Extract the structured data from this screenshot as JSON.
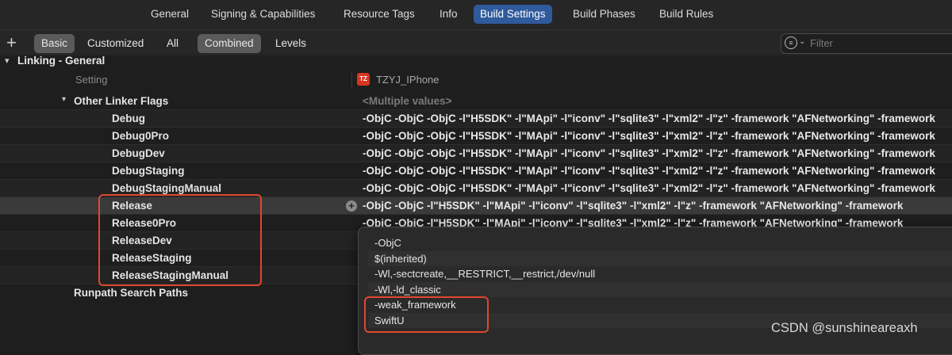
{
  "tabs": [
    {
      "label": "General"
    },
    {
      "label": "Signing & Capabilities"
    },
    {
      "label": "Resource Tags"
    },
    {
      "label": "Info"
    },
    {
      "label": "Build Settings",
      "active": true
    },
    {
      "label": "Build Phases"
    },
    {
      "label": "Build Rules"
    }
  ],
  "toolbar": {
    "add_label": "+",
    "scope": [
      "Basic",
      "Customized",
      "All"
    ],
    "view": [
      "Combined",
      "Levels"
    ],
    "filter_placeholder": "Filter"
  },
  "section": {
    "title": "Linking - General"
  },
  "header": {
    "setting_label": "Setting",
    "target_name": "TZYJ_IPhone",
    "target_icon": "app-icon"
  },
  "flags": {
    "name": "Other Linker Flags",
    "value": "<Multiple values>",
    "configs": [
      {
        "name": "Debug",
        "value": "-ObjC -ObjC -ObjC -l\"H5SDK\" -l\"MApi\" -l\"iconv\" -l\"sqlite3\" -l\"xml2\" -l\"z\" -framework \"AFNetworking\" -framework"
      },
      {
        "name": "Debug0Pro",
        "value": "-ObjC -ObjC -ObjC -l\"H5SDK\" -l\"MApi\" -l\"iconv\" -l\"sqlite3\" -l\"xml2\" -l\"z\" -framework \"AFNetworking\" -framework"
      },
      {
        "name": "DebugDev",
        "value": "-ObjC -ObjC -ObjC -l\"H5SDK\" -l\"MApi\" -l\"iconv\" -l\"sqlite3\" -l\"xml2\" -l\"z\" -framework \"AFNetworking\" -framework"
      },
      {
        "name": "DebugStaging",
        "value": "-ObjC -ObjC -ObjC -l\"H5SDK\" -l\"MApi\" -l\"iconv\" -l\"sqlite3\" -l\"xml2\" -l\"z\" -framework \"AFNetworking\" -framework"
      },
      {
        "name": "DebugStagingManual",
        "value": "-ObjC -ObjC -ObjC -l\"H5SDK\" -l\"MApi\" -l\"iconv\" -l\"sqlite3\" -l\"xml2\" -l\"z\" -framework \"AFNetworking\" -framework"
      },
      {
        "name": "Release",
        "value": "-ObjC  -ObjC -l\"H5SDK\" -l\"MApi\" -l\"iconv\" -l\"sqlite3\" -l\"xml2\" -l\"z\" -framework \"AFNetworking\" -framework"
      },
      {
        "name": "Release0Pro",
        "value": "-ObjC -ObjC -l\"H5SDK\" -l\"MApi\" -l\"iconv\" -l\"sqlite3\" -l\"xml2\" -l\"z\" -framework \"AFNetworking\" -framework"
      },
      {
        "name": "ReleaseDev",
        "value": ""
      },
      {
        "name": "ReleaseStaging",
        "value": ""
      },
      {
        "name": "ReleaseStagingManual",
        "value": ""
      }
    ]
  },
  "runpath": {
    "name": "Runpath Search Paths"
  },
  "popup": {
    "lines": [
      "-ObjC",
      "$(inherited)",
      "-Wl,-sectcreate,__RESTRICT,__restrict,/dev/null",
      "-Wl,-ld_classic",
      "-weak_framework",
      "SwiftU"
    ]
  },
  "watermark": "CSDN @sunshineareaxh",
  "colors": {
    "accent": "#2f5a9c",
    "highlight": "#e0472e"
  }
}
